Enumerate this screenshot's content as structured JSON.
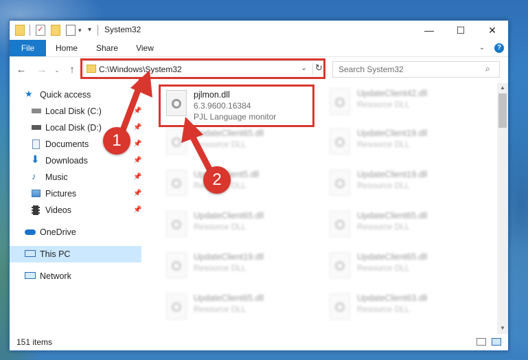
{
  "window": {
    "title": "System32",
    "buttons": {
      "minimize": "—",
      "maximize": "☐",
      "close": "✕"
    }
  },
  "ribbon": {
    "tabs": [
      "File",
      "Home",
      "Share",
      "View"
    ],
    "expand_icon": "chevron-down-icon",
    "help_icon": "help-icon"
  },
  "address_bar": {
    "path": "C:\\Windows\\System32",
    "search_placeholder": "Search System32"
  },
  "sidebar": {
    "items": [
      {
        "label": "Quick access",
        "icon": "star-icon",
        "pinned": false
      },
      {
        "label": "Local Disk (C:)",
        "icon": "drive-icon",
        "pinned": true
      },
      {
        "label": "Local Disk (D:)",
        "icon": "drive-icon",
        "pinned": true
      },
      {
        "label": "Documents",
        "icon": "documents-icon",
        "pinned": true
      },
      {
        "label": "Downloads",
        "icon": "downloads-icon",
        "pinned": true
      },
      {
        "label": "Music",
        "icon": "music-icon",
        "pinned": true
      },
      {
        "label": "Pictures",
        "icon": "pictures-icon",
        "pinned": true
      },
      {
        "label": "Videos",
        "icon": "videos-icon",
        "pinned": true
      },
      {
        "label": "OneDrive",
        "icon": "cloud-icon",
        "pinned": false
      },
      {
        "label": "This PC",
        "icon": "computer-icon",
        "pinned": false,
        "selected": true
      },
      {
        "label": "Network",
        "icon": "network-icon",
        "pinned": false
      }
    ]
  },
  "files": {
    "highlighted": {
      "name": "pjlmon.dll",
      "version": "6.3.9600.16384",
      "description": "PJL Language monitor"
    },
    "left_column": [
      {
        "name": "UpdateClient65.dll",
        "description": "Resource DLL"
      },
      {
        "name": "UpdateClient5.dll",
        "description": "Resource DLL"
      },
      {
        "name": "UpdateClient65.dll",
        "description": "Resource DLL"
      },
      {
        "name": "UpdateClient19.dll",
        "description": "Resource DLL"
      },
      {
        "name": "UpdateClient65.dll",
        "description": "Resource DLL"
      }
    ],
    "right_column": [
      {
        "name": "UpdateClient42.dll",
        "description": "Resource DLL"
      },
      {
        "name": "UpdateClient19.dll",
        "description": "Resource DLL"
      },
      {
        "name": "UpdateClient19.dll",
        "description": "Resource DLL"
      },
      {
        "name": "UpdateClient65.dll",
        "description": "Resource DLL"
      },
      {
        "name": "UpdateClient65.dll",
        "description": "Resource DLL"
      },
      {
        "name": "UpdateClient63.dll",
        "description": "Resource DLL"
      }
    ]
  },
  "status": {
    "item_count": "151 items"
  },
  "annotations": {
    "step1": "1",
    "step2": "2"
  },
  "colors": {
    "accent": "#1979ca",
    "highlight": "#d9362e",
    "selected": "#cce8ff"
  }
}
